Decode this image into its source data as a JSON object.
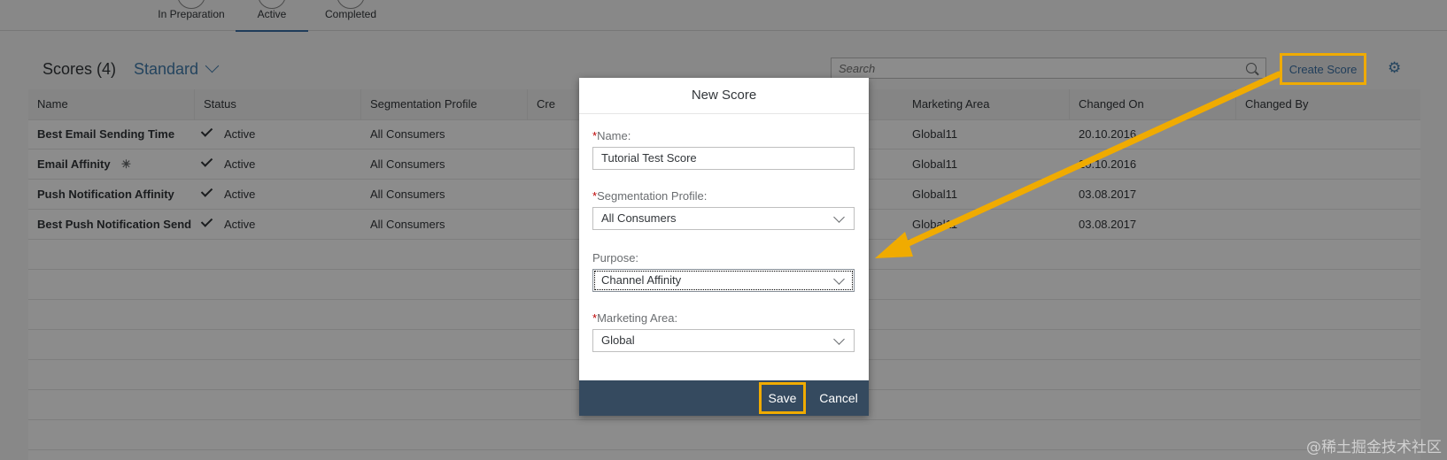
{
  "icon_tabs": [
    {
      "label": "In Preparation",
      "active": false
    },
    {
      "label": "Active",
      "active": true
    },
    {
      "label": "Completed",
      "active": false
    }
  ],
  "toolbar": {
    "title": "Scores (4)",
    "variant": "Standard",
    "search_placeholder": "Search",
    "create_label": "Create Score",
    "settings_icon": "gear-icon"
  },
  "table": {
    "columns": [
      "Name",
      "Status",
      "Segmentation Profile",
      "Cre",
      "Marketing Area",
      "Changed On",
      "Changed By"
    ],
    "rows": [
      {
        "name": "Best Email Sending Time",
        "status": "Active",
        "profile": "All Consumers",
        "area": "Global11",
        "changed_on": "20.10.2016"
      },
      {
        "name": "Email Affinity",
        "status": "Active",
        "profile": "All Consumers",
        "area": "Global11",
        "changed_on": "20.10.2016"
      },
      {
        "name": "Push Notification Affinity",
        "status": "Active",
        "profile": "All Consumers",
        "area": "Global11",
        "changed_on": "03.08.2017"
      },
      {
        "name": "Best Push Notification Send",
        "status": "Active",
        "profile": "All Consumers",
        "area": "Global11",
        "changed_on": "03.08.2017"
      }
    ]
  },
  "dialog": {
    "title": "New Score",
    "name_label": "Name:",
    "name_value": "Tutorial Test Score",
    "profile_label": "Segmentation Profile:",
    "profile_value": "All Consumers",
    "purpose_label": "Purpose:",
    "purpose_value": "Channel Affinity",
    "area_label": "Marketing Area:",
    "area_value": "Global",
    "save_label": "Save",
    "cancel_label": "Cancel"
  },
  "colors": {
    "highlight": "#f0ab00",
    "footer": "#354a5f",
    "link": "#427cac"
  },
  "watermark": "@稀土掘金技术社区"
}
